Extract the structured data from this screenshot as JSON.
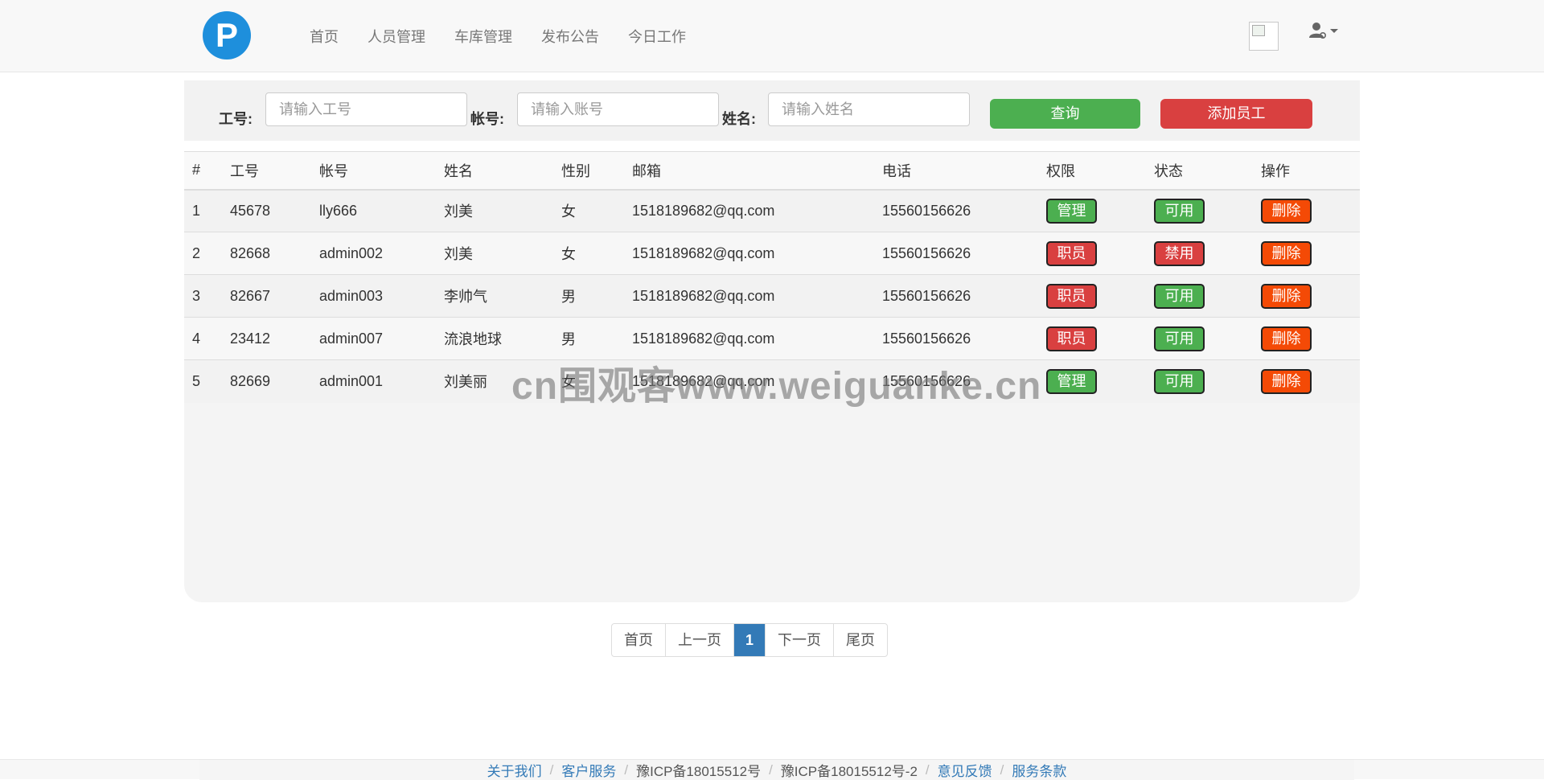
{
  "nav": {
    "logo_letter": "P",
    "links": [
      "首页",
      "人员管理",
      "车库管理",
      "发布公告",
      "今日工作"
    ],
    "user_icon": "user-gear-icon"
  },
  "search": {
    "id_label": "工号:",
    "id_placeholder": "请输入工号",
    "account_label": "帐号:",
    "account_placeholder": "请输入账号",
    "name_label": "姓名:",
    "name_placeholder": "请输入姓名",
    "search_button": "查询",
    "add_button": "添加员工"
  },
  "table": {
    "headers": [
      "#",
      "工号",
      "帐号",
      "姓名",
      "性别",
      "邮箱",
      "电话",
      "权限",
      "状态",
      "操作"
    ],
    "rows": [
      {
        "no": "1",
        "id": "45678",
        "account": "lly666",
        "name": "刘美",
        "gender": "女",
        "email": "1518189682@qq.com",
        "phone": "15560156626",
        "role": "管理",
        "status": "可用",
        "action": "删除"
      },
      {
        "no": "2",
        "id": "82668",
        "account": "admin002",
        "name": "刘美",
        "gender": "女",
        "email": "1518189682@qq.com",
        "phone": "15560156626",
        "role": "职员",
        "status": "禁用",
        "action": "删除"
      },
      {
        "no": "3",
        "id": "82667",
        "account": "admin003",
        "name": "李帅气",
        "gender": "男",
        "email": "1518189682@qq.com",
        "phone": "15560156626",
        "role": "职员",
        "status": "可用",
        "action": "删除"
      },
      {
        "no": "4",
        "id": "23412",
        "account": "admin007",
        "name": "流浪地球",
        "gender": "男",
        "email": "1518189682@qq.com",
        "phone": "15560156626",
        "role": "职员",
        "status": "可用",
        "action": "删除"
      },
      {
        "no": "5",
        "id": "82669",
        "account": "admin001",
        "name": "刘美丽",
        "gender": "女",
        "email": "1518189682@qq.com",
        "phone": "15560156626",
        "role": "管理",
        "status": "可用",
        "action": "删除"
      }
    ]
  },
  "watermark": "cn围观客www.weiguanke.cn",
  "pagination": {
    "first": "首页",
    "prev": "上一页",
    "current": "1",
    "next": "下一页",
    "last": "尾页"
  },
  "footer": {
    "about": "关于我们",
    "service": "客户服务",
    "icp1": "豫ICP备18015512号",
    "icp2": "豫ICP备18015512号-2",
    "feedback": "意见反馈",
    "terms": "服务条款"
  },
  "colors": {
    "green": "#4caf50",
    "red": "#d94040",
    "orange": "#f44a06",
    "primary": "#337ab7"
  }
}
